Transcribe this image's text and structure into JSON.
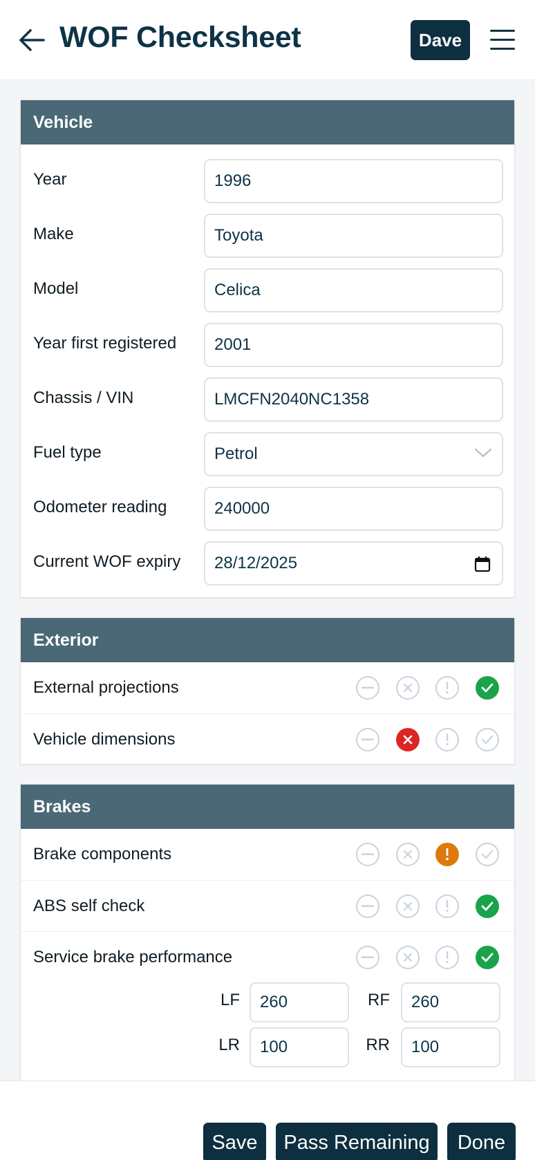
{
  "header": {
    "title": "WOF Checksheet",
    "user_label": "Dave"
  },
  "vehicle": {
    "section_title": "Vehicle",
    "fields": [
      {
        "label": "Year",
        "value": "1996"
      },
      {
        "label": "Make",
        "value": "Toyota"
      },
      {
        "label": "Model",
        "value": "Celica"
      },
      {
        "label": "Year first registered",
        "value": "2001"
      },
      {
        "label": "Chassis / VIN",
        "value": "LMCFN2040NC1358"
      },
      {
        "label": "Fuel type",
        "value": "Petrol"
      },
      {
        "label": "Odometer reading",
        "value": "240000"
      },
      {
        "label": "Current WOF expiry",
        "value": "28/12/2025"
      }
    ]
  },
  "exterior": {
    "section_title": "Exterior",
    "items": [
      {
        "label": "External projections",
        "status": "pass"
      },
      {
        "label": "Vehicle dimensions",
        "status": "fail"
      }
    ]
  },
  "brakes": {
    "section_title": "Brakes",
    "items": [
      {
        "label": "Brake components",
        "status": "warn"
      },
      {
        "label": "ABS self check",
        "status": "pass"
      },
      {
        "label": "Service brake performance",
        "status": "pass"
      }
    ],
    "performance": {
      "lf_label": "LF",
      "lf_value": "260",
      "rf_label": "RF",
      "rf_value": "260",
      "lr_label": "LR",
      "lr_value": "100",
      "rr_label": "RR",
      "rr_value": "100"
    }
  },
  "footer": {
    "save_label": "Save",
    "pass_remaining_label": "Pass Remaining",
    "done_label": "Done"
  },
  "colors": {
    "header_bg": "#4a6875",
    "primary_button": "#0d2f40",
    "pass": "#1aa34a",
    "fail": "#dc2626",
    "warn": "#dc7a0c"
  }
}
